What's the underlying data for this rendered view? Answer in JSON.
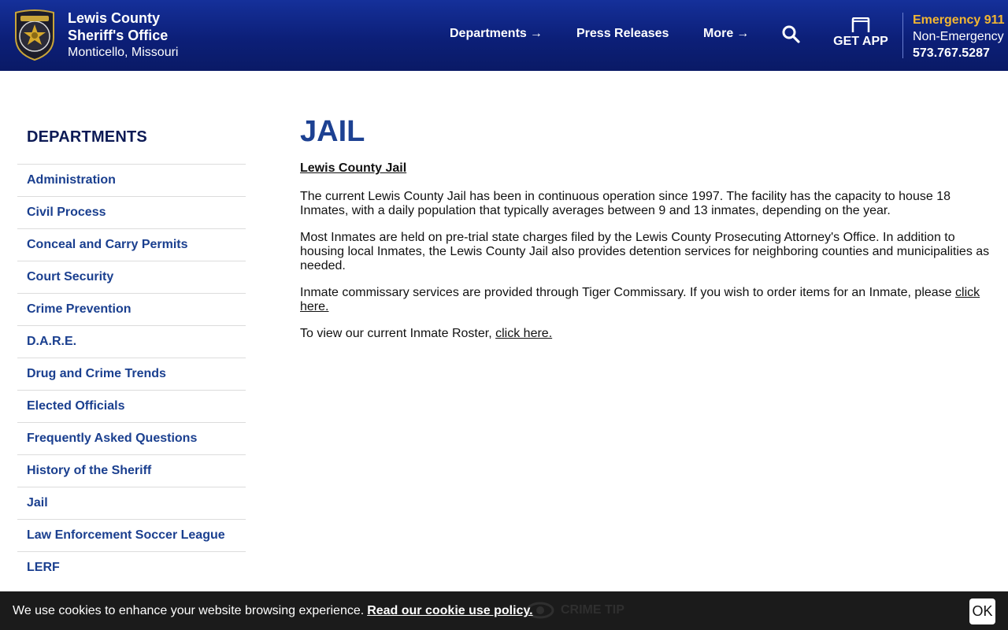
{
  "header": {
    "name_line1": "Lewis County",
    "name_line2": "Sheriff's Office",
    "location": "Monticello, Missouri",
    "nav": {
      "departments": "Departments",
      "press": "Press Releases",
      "more": "More"
    },
    "get_app": "GET APP",
    "emergency": "Emergency 911",
    "non_emergency_label": "Non-Emergency",
    "non_emergency_phone": "573.767.5287"
  },
  "sidebar": {
    "title": "DEPARTMENTS",
    "items": [
      {
        "label": "Administration"
      },
      {
        "label": "Civil Process"
      },
      {
        "label": "Conceal and Carry Permits"
      },
      {
        "label": "Court Security"
      },
      {
        "label": "Crime Prevention"
      },
      {
        "label": "D.A.R.E."
      },
      {
        "label": "Drug and Crime Trends"
      },
      {
        "label": "Elected Officials"
      },
      {
        "label": "Frequently Asked Questions"
      },
      {
        "label": "History of the Sheriff"
      },
      {
        "label": "Jail"
      },
      {
        "label": "Law Enforcement Soccer League"
      },
      {
        "label": "LERF"
      }
    ]
  },
  "main": {
    "title": "JAIL",
    "section_title": "Lewis County Jail",
    "p1": "The current Lewis County Jail has been in continuous operation since 1997. The facility has the capacity to house 18 Inmates, with a daily population that typically averages between 9 and 13 inmates, depending on the year.",
    "p2": "Most Inmates are held on pre-trial state charges filed by the Lewis County Prosecuting Attorney's Office. In addition to housing local Inmates, the Lewis County Jail also provides detention services for neighboring counties and municipalities as needed.",
    "p3_text": "Inmate commissary services are provided through Tiger Commissary. If you wish to order items for an Inmate, please ",
    "p3_link": "click here.",
    "p4_text": "To view our current Inmate Roster, ",
    "p4_link": "click here."
  },
  "cookie": {
    "text": "We use cookies to enhance your website browsing experience.",
    "link": "Read our cookie use policy.",
    "ok": "OK",
    "crime_tip": "CRIME TIP"
  },
  "colors": {
    "header_bg": "#0c1f78",
    "emergency": "#f2b632",
    "link": "#1a3f8f",
    "title": "#1d4192"
  }
}
